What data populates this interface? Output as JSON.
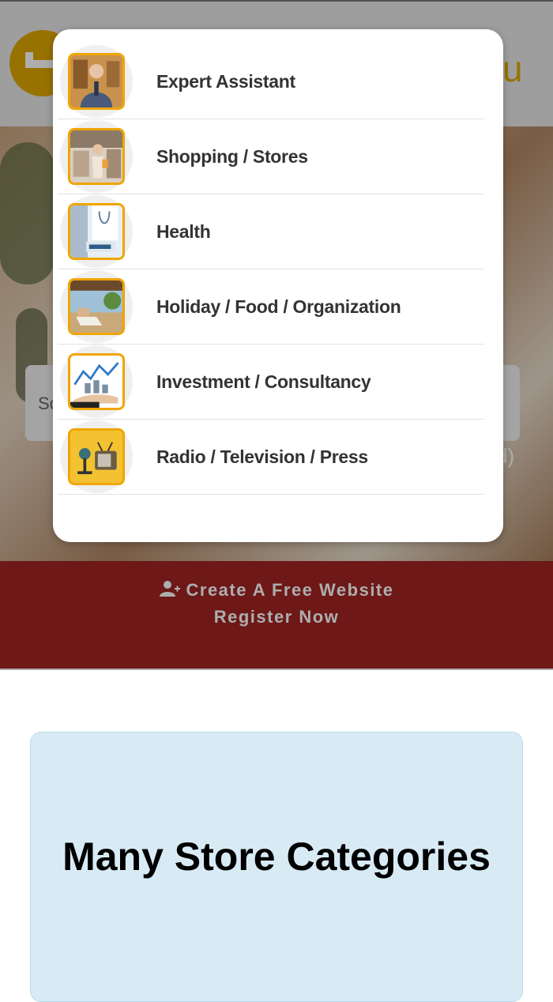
{
  "background": {
    "menu_partial": "u",
    "search_placeholder_partial": "Sc",
    "hero_suffix": "d)",
    "cta": {
      "line1": "Create A Free Website",
      "line2": "Register Now"
    },
    "info_card_title": "Many Store Categories"
  },
  "modal": {
    "categories": [
      {
        "label": "Expert Assistant",
        "icon": "expert-assistant-icon"
      },
      {
        "label": "Shopping / Stores",
        "icon": "shopping-icon"
      },
      {
        "label": "Health",
        "icon": "health-icon"
      },
      {
        "label": "Holiday / Food / Organization",
        "icon": "holiday-icon"
      },
      {
        "label": "Investment / Consultancy",
        "icon": "investment-icon"
      },
      {
        "label": "Radio / Television / Press",
        "icon": "radio-tv-icon"
      }
    ]
  },
  "colors": {
    "brand_yellow": "#e0a800",
    "cta_red": "#a32424",
    "thumb_border": "#f0a500",
    "card_blue": "#d8ebf5"
  }
}
